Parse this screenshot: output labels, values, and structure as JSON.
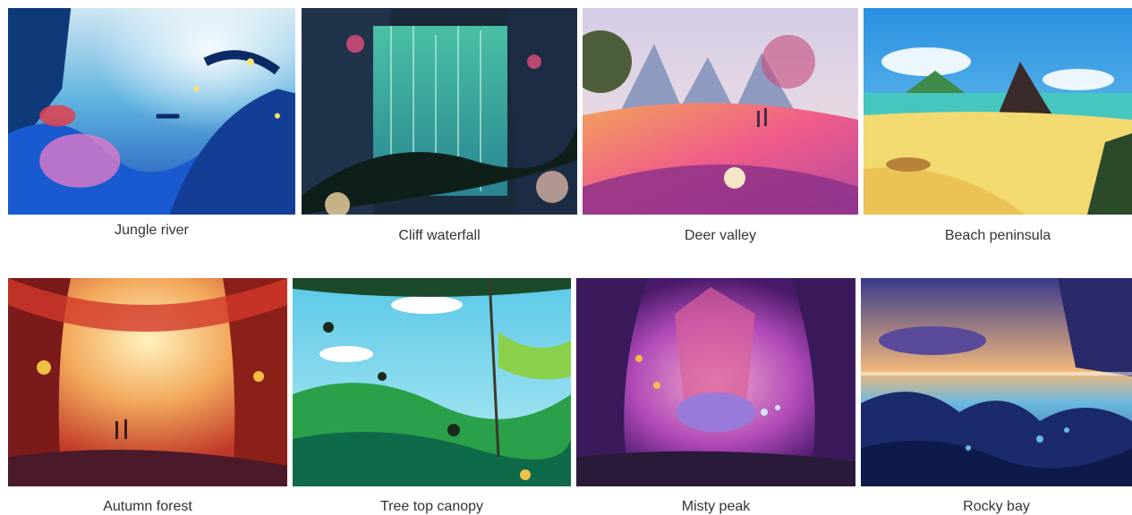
{
  "gallery": {
    "items": [
      {
        "caption": "Jungle river"
      },
      {
        "caption": "Cliff waterfall"
      },
      {
        "caption": "Deer valley"
      },
      {
        "caption": "Beach peninsula"
      },
      {
        "caption": "Autumn forest"
      },
      {
        "caption": "Tree top canopy"
      },
      {
        "caption": "Misty peak"
      },
      {
        "caption": "Rocky bay"
      }
    ]
  }
}
